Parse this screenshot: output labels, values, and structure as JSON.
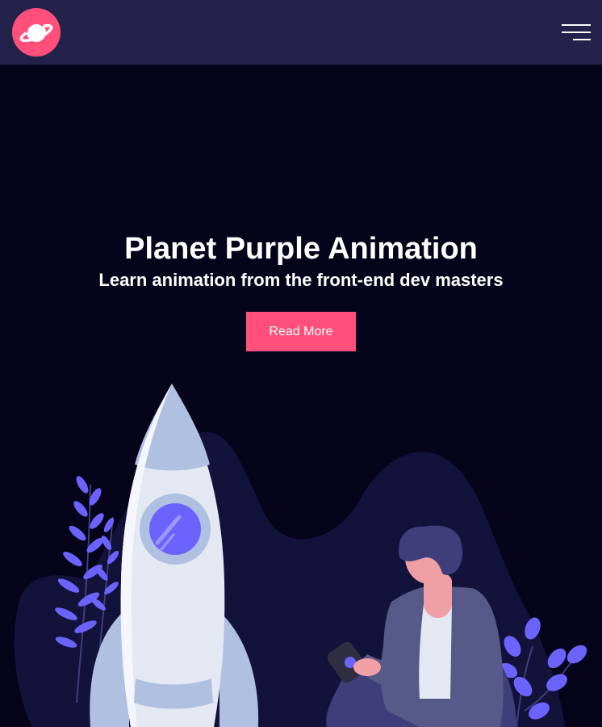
{
  "navbar": {
    "logo_icon": "planet-icon",
    "menu_icon": "hamburger-menu-icon"
  },
  "hero": {
    "title": "Planet Purple Animation",
    "subtitle": "Learn animation from the front-end dev masters",
    "cta_label": "Read More"
  },
  "colors": {
    "navbar_bg": "#22224a",
    "page_bg": "#05041a",
    "accent": "#ff4f7a",
    "hill": "#13123a",
    "rocket_body": "#e4e8f3",
    "rocket_shade": "#b0c0e0",
    "porthole": "#6c63ff",
    "plant": "#6c63ff",
    "person_jacket": "#575a89",
    "person_skin": "#f0a0a5"
  },
  "illustration": {
    "icons": [
      "rocket-illustration",
      "person-illustration",
      "plant-illustration"
    ]
  }
}
